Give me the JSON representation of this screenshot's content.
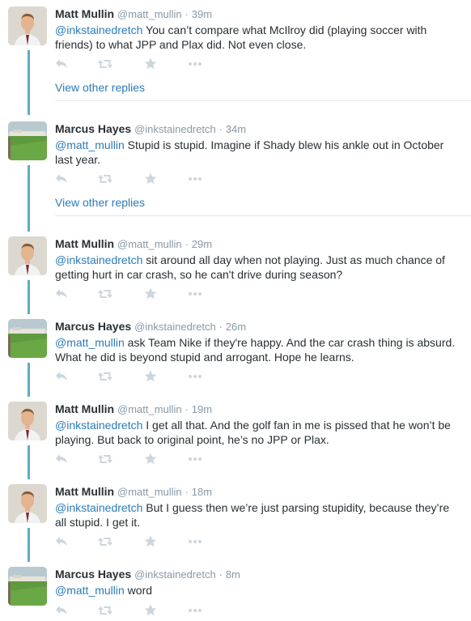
{
  "tweets": [
    {
      "name": "Matt Mullin",
      "handle": "@matt_mullin",
      "time": "39m",
      "mention": "@inkstainedretch",
      "body": " You can’t compare what McIlroy did (playing soccer with friends) to what JPP and Plax did. Not even close.",
      "avatar": "person"
    },
    {
      "name": "Marcus Hayes",
      "handle": "@inkstainedretch",
      "time": "34m",
      "mention": "@matt_mullin",
      "body": " Stupid is stupid. Imagine if Shady blew his ankle out in October last year.",
      "avatar": "field"
    },
    {
      "name": "Matt Mullin",
      "handle": "@matt_mullin",
      "time": "29m",
      "mention": "@inkstainedretch",
      "body": " sit around all day when not playing. Just as much chance of getting hurt in car crash, so he can't drive during season?",
      "avatar": "person"
    },
    {
      "name": "Marcus Hayes",
      "handle": "@inkstainedretch",
      "time": "26m",
      "mention": "@matt_mullin",
      "body": " ask Team Nike if they're happy. And the car crash thing is absurd. What he did is beyond stupid and arrogant. Hope he learns.",
      "avatar": "field"
    },
    {
      "name": "Matt Mullin",
      "handle": "@matt_mullin",
      "time": "19m",
      "mention": "@inkstainedretch",
      "body": " I get all that. And the golf fan in me is pissed that he won’t be playing. But back to original point, he’s no JPP or Plax.",
      "avatar": "person"
    },
    {
      "name": "Matt Mullin",
      "handle": "@matt_mullin",
      "time": "18m",
      "mention": "@inkstainedretch",
      "body": " But I guess then we’re just parsing stupidity, because they’re all stupid. I get it.",
      "avatar": "person"
    },
    {
      "name": "Marcus Hayes",
      "handle": "@inkstainedretch",
      "time": "8m",
      "mention": "@matt_mullin",
      "body": " word",
      "avatar": "field"
    }
  ],
  "separator": "·",
  "view_other_replies": "View other replies",
  "icons": [
    "reply-icon",
    "retweet-icon",
    "favorite-icon",
    "more-icon"
  ],
  "colors": {
    "link": "#2b7bb9",
    "thread": "#5dadc5",
    "muted": "#8899a6",
    "icon": "#ccd6dd"
  }
}
